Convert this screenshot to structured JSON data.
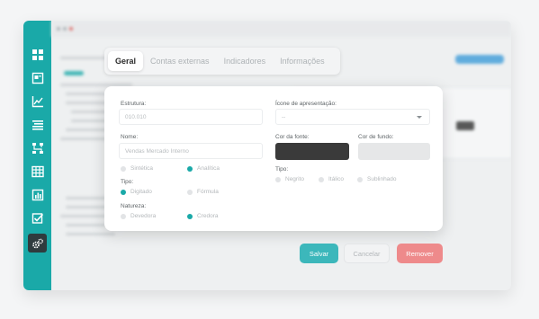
{
  "tabs": [
    {
      "label": "Geral",
      "active": true
    },
    {
      "label": "Contas externas",
      "active": false
    },
    {
      "label": "Indicadores",
      "active": false
    },
    {
      "label": "Informações",
      "active": false
    }
  ],
  "sidebar": {
    "icons": [
      "dashboard-icon",
      "report-icon",
      "line-chart-icon",
      "list-icon",
      "hierarchy-icon",
      "table-icon",
      "bar-chart-icon",
      "checkbox-icon",
      "settings-icon"
    ],
    "active_icon": "settings-icon"
  },
  "form": {
    "estrutura_label": "Estrutura:",
    "estrutura_value": "010.010",
    "nome_label": "Nome:",
    "nome_placeholder": "Vendas Mercado Interno",
    "sintetica_label": "Sintética",
    "analitica_label": "Analítica",
    "tipo_left_label": "Tipo:",
    "digitado_label": "Digitado",
    "formula_label": "Fórmula",
    "natureza_label": "Natureza:",
    "devedora_label": "Devedora",
    "credora_label": "Credora",
    "icone_label": "Ícone de apresentação:",
    "icone_value": "--",
    "cor_fonte_label": "Cor da fonte:",
    "cor_fundo_label": "Cor de fundo:",
    "cor_fonte_color": "#3a3a3a",
    "cor_fundo_color": "#e6e7e8",
    "tipo_right_label": "Tipo:",
    "negrito_label": "Negrito",
    "italico_label": "Itálico",
    "sublinhado_label": "Sublinhado",
    "selected": {
      "sintetica_analitica": "Analítica",
      "tipo": "Digitado",
      "natureza": "Credora"
    }
  },
  "actions": {
    "save_label": "Salvar",
    "cancel_label": "Cancelar",
    "remove_label": "Remover"
  },
  "colors": {
    "accent": "#1aa9a8",
    "save": "#3cb7bb",
    "remove": "#ee8a8b"
  }
}
